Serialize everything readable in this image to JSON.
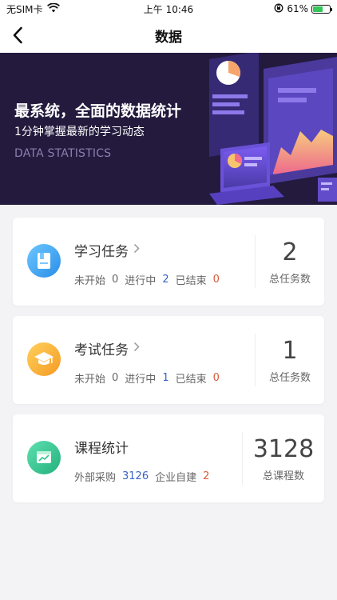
{
  "status_bar": {
    "carrier": "无SIM卡",
    "time": "上午 10:46",
    "battery_text": "61%",
    "battery_level": 0.61
  },
  "nav": {
    "title": "数据"
  },
  "banner": {
    "title": "最系统，全面的数据统计",
    "subtitle": "1分钟掌握最新的学习动态",
    "english": "DATA STATISTICS"
  },
  "cards": [
    {
      "title": "学习任务",
      "stats": [
        {
          "label": "未开始",
          "value": "0"
        },
        {
          "label": "进行中",
          "value": "2"
        },
        {
          "label": "已结束",
          "value": "0"
        }
      ],
      "total": "2",
      "total_label": "总任务数",
      "icon": "book-icon",
      "icon_color": "#3aa3f0"
    },
    {
      "title": "考试任务",
      "stats": [
        {
          "label": "未开始",
          "value": "0"
        },
        {
          "label": "进行中",
          "value": "1"
        },
        {
          "label": "已结束",
          "value": "0"
        }
      ],
      "total": "1",
      "total_label": "总任务数",
      "icon": "graduation-cap-icon",
      "icon_color": "#f5a623"
    },
    {
      "title": "课程统计",
      "stats": [
        {
          "label": "外部采购",
          "value": "3126"
        },
        {
          "label": "企业自建",
          "value": "2"
        }
      ],
      "total": "3128",
      "total_label": "总课程数",
      "icon": "course-chart-icon",
      "icon_color": "#2fc48f"
    }
  ]
}
